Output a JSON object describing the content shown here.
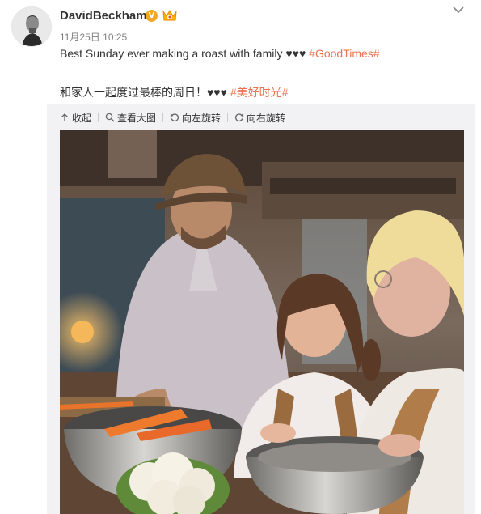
{
  "post": {
    "username": "DavidBeckham",
    "verified_badge": "V",
    "timestamp": "11月25日 10:25",
    "text_line1": "Best Sunday ever making a roast with family ♥♥♥ ",
    "text_line1_tag": "#GoodTimes#",
    "text_line2": "和家人一起度过最棒的周日！♥♥♥ ",
    "text_line2_tag": "#美好时光#"
  },
  "toolbar": {
    "collapse": "收起",
    "view_large": "查看大图",
    "rotate_left": "向左旋转",
    "rotate_right": "向右旋转"
  },
  "colors": {
    "hashtag": "#eb7350",
    "verified": "#f5a623",
    "media_bg": "#f2f2f5"
  },
  "icons": {
    "more": "chevron-down-icon",
    "collapse": "arrow-up-icon",
    "view_large": "magnifier-icon",
    "rotate_left": "rotate-left-icon",
    "rotate_right": "rotate-right-icon"
  }
}
